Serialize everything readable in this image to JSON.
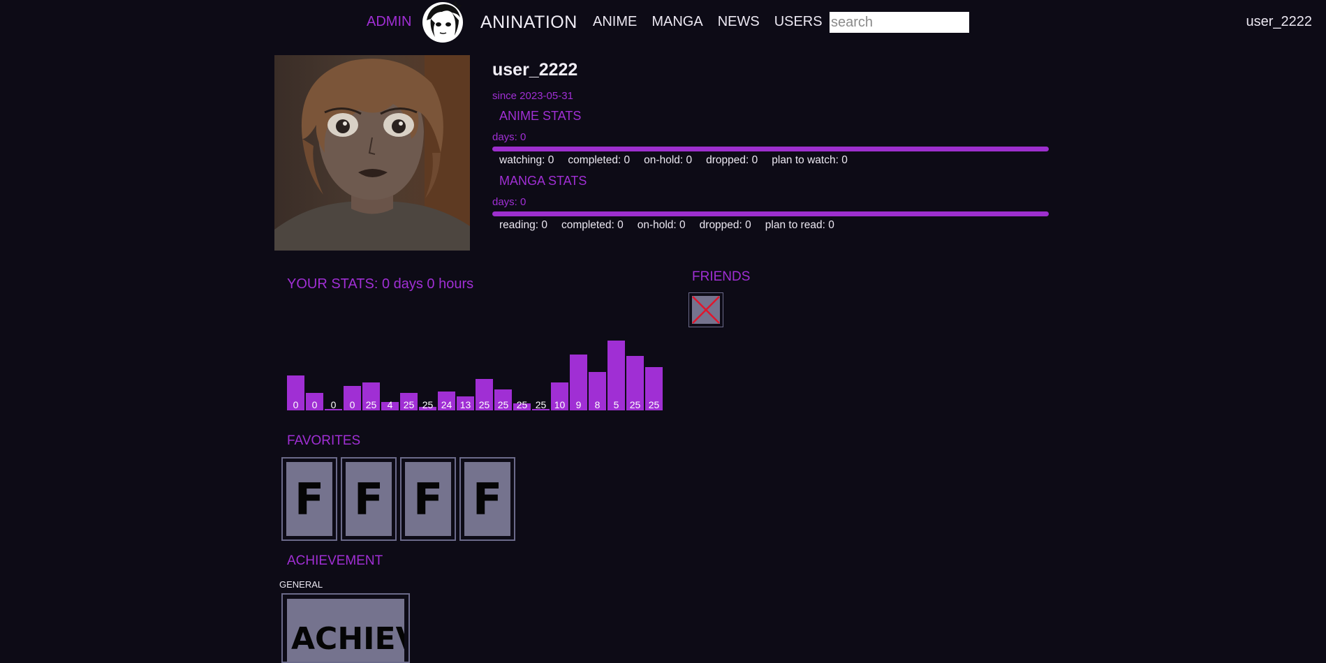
{
  "nav": {
    "admin_label": "ADMIN",
    "brand": "ANINATION",
    "links": [
      "ANIME",
      "MANGA",
      "NEWS",
      "USERS"
    ],
    "search_placeholder": "search",
    "current_user": "user_2222"
  },
  "profile": {
    "username": "user_2222",
    "since": "since 2023-05-31",
    "anime_stats": {
      "title": "ANIME STATS",
      "days": "days: 0",
      "progress": 1.0,
      "counts": [
        "watching: 0",
        "completed: 0",
        "on-hold: 0",
        "dropped: 0",
        "plan to watch: 0"
      ]
    },
    "manga_stats": {
      "title": "MANGA STATS",
      "days": "days: 0",
      "progress": 1.0,
      "counts": [
        "reading: 0",
        "completed: 0",
        "on-hold: 0",
        "dropped: 0",
        "plan to read: 0"
      ]
    }
  },
  "your_stats": {
    "title": "YOUR STATS: 0 days 0 hours"
  },
  "chart_data": {
    "type": "bar",
    "title": "",
    "values": [
      50,
      25,
      2,
      35,
      40,
      12,
      25,
      5,
      27,
      20,
      45,
      30,
      10,
      0,
      40,
      80,
      55,
      100,
      78,
      62
    ],
    "labels": [
      "0",
      "0",
      "0",
      "0",
      "25",
      "4",
      "25",
      "25",
      "24",
      "13",
      "25",
      "25",
      "25",
      "25",
      "10",
      "9",
      "8",
      "5",
      "25",
      "25"
    ],
    "color": "#a02fd4"
  },
  "friends": {
    "title": "FRIENDS",
    "broken_image_icon": "broken-image-icon"
  },
  "favorites": {
    "title": "FAVORITES",
    "items": [
      "F",
      "F",
      "F",
      "F"
    ]
  },
  "achievement": {
    "title": "ACHIEVEMENT",
    "category": "GENERAL",
    "card_text": "ACHIEV"
  },
  "colors": {
    "background": "#0d0b16",
    "accent": "#a02fd4",
    "card_fill": "#75738e",
    "card_border": "#6b6a8a"
  }
}
